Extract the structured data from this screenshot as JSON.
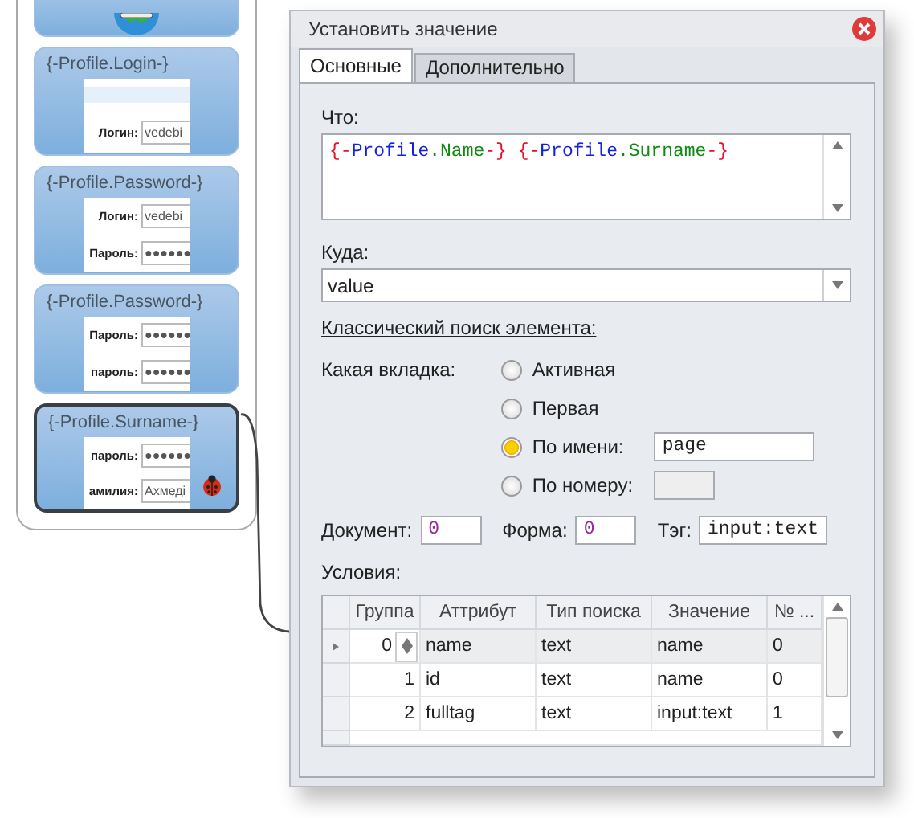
{
  "canvas": {
    "cards": [
      {
        "selected": false,
        "kind": "globe"
      },
      {
        "title": "{-Profile.Login-}",
        "selected": false,
        "kind": "preview",
        "preview": [
          {
            "kind": "bar"
          },
          {
            "kind": "field",
            "label": "Логин:",
            "value": "vedebi"
          }
        ]
      },
      {
        "title": "{-Profile.Password-}",
        "selected": false,
        "kind": "preview",
        "preview": [
          {
            "kind": "field",
            "label": "Логин:",
            "value": "vedebi"
          },
          {
            "kind": "field",
            "label": "Пароль:",
            "value": "●●●●●●"
          }
        ]
      },
      {
        "title": "{-Profile.Password-}",
        "selected": false,
        "kind": "preview",
        "preview": [
          {
            "kind": "field",
            "label": "Пароль:",
            "value": "●●●●●●"
          },
          {
            "kind": "field",
            "label": "пароль:",
            "value": "●●●●●●"
          }
        ]
      },
      {
        "title": "{-Profile.Surname-}",
        "selected": true,
        "kind": "preview",
        "debug": true,
        "preview": [
          {
            "kind": "field",
            "label": "пароль:",
            "value": "●●●●●●"
          },
          {
            "kind": "field",
            "label": "амилия:",
            "value": "Ахмеді"
          }
        ]
      }
    ]
  },
  "dialog": {
    "title": "Установить значение",
    "tabs": [
      {
        "label": "Основные",
        "selected": true
      },
      {
        "label": "Дополнительно",
        "selected": false
      }
    ],
    "what": {
      "label": "Что:",
      "tokens": [
        {
          "text": "{-",
          "kind": "delimiter"
        },
        {
          "text": "Profile",
          "kind": "object"
        },
        {
          "text": ".Name",
          "kind": "property"
        },
        {
          "text": "-}",
          "kind": "delimiter"
        },
        {
          "text": "{-",
          "kind": "delimiter",
          "gap_before": true
        },
        {
          "text": "Profile",
          "kind": "object"
        },
        {
          "text": ".Surname",
          "kind": "property"
        },
        {
          "text": "-}",
          "kind": "delimiter"
        }
      ]
    },
    "where": {
      "label": "Куда:",
      "value": "value"
    },
    "search_link": "Классический поиск элемента:",
    "tab_choice": {
      "label": "Какая вкладка:",
      "options": [
        {
          "label": "Активная",
          "selected": false,
          "kind": "plain"
        },
        {
          "label": "Первая",
          "selected": false,
          "kind": "plain"
        },
        {
          "label": "По имени:",
          "selected": true,
          "kind": "field",
          "value": "page",
          "disabled": false
        },
        {
          "label": "По номеру:",
          "selected": false,
          "kind": "field",
          "disabled": true
        }
      ]
    },
    "document": {
      "label": "Документ:",
      "value": "0"
    },
    "form": {
      "label": "Форма:",
      "value": "0"
    },
    "tag": {
      "label": "Тэг:",
      "value": "input:text"
    },
    "conditions": {
      "label": "Условия:",
      "columns": [
        "Группа",
        "Аттрибут",
        "Тип поиска",
        "Значение",
        "№ ..."
      ],
      "rows": [
        {
          "selected": true,
          "cells": [
            "0",
            "name",
            "text",
            "name",
            "0"
          ]
        },
        {
          "selected": false,
          "cells": [
            "1",
            "id",
            "text",
            "name",
            "0"
          ]
        },
        {
          "selected": false,
          "cells": [
            "2",
            "fulltag",
            "text",
            "input:text",
            "1"
          ]
        }
      ]
    }
  }
}
